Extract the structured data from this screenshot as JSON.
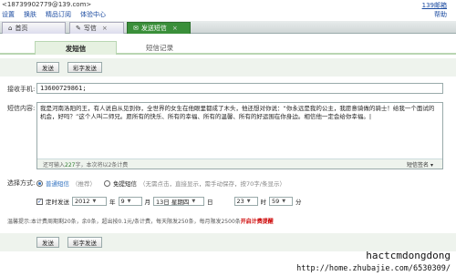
{
  "topbar": {
    "account": "<18739902779@139.com>",
    "links": [
      "设置",
      "换肤",
      "精品订阅",
      "体验中心"
    ],
    "brand": "139邮箱",
    "help": "帮助"
  },
  "tabs": [
    {
      "label": "首页"
    },
    {
      "label": "写信"
    },
    {
      "label": "发送短信"
    }
  ],
  "subtabs": {
    "active": "发短信",
    "other": "短信记录"
  },
  "buttons": {
    "send": "发送",
    "mms_send": "彩字发送"
  },
  "phone": {
    "label": "接收手机:",
    "value": "13600729861;"
  },
  "message": {
    "label": "短信内容:",
    "text": "我是河南洛阳的王，有人说自从见到你，全世界的女生在他眼里都成了木头，他还想对你说：“你永远是我的公主，我愿意骑做的骑士！给我一个面试的机会，好吗？”这个人叫二师兄。愿所有的快乐、所有的幸福、所有的温馨、所有的好运围在你身边。相信他一定会给你幸福。|",
    "counter_prefix": "还可输入",
    "counter_value": "227",
    "counter_suffix": "字，本次将以2条计费",
    "signature": "短信签名"
  },
  "options": {
    "label": "选择方式:",
    "normal": "普通短信",
    "normal_note": "（推荐）",
    "flash": "免提短信",
    "flash_note": "（无需点击，直接显示，需手动保存，按70字/条显示）"
  },
  "schedule": {
    "label": "定时发送",
    "year": "2012",
    "year_unit": "年",
    "month": "9",
    "month_unit": "月",
    "day": "13日 星期四",
    "day_unit": "日",
    "hour": "23",
    "hour_unit": "时",
    "minute": "59",
    "minute_unit": "分"
  },
  "tip": {
    "text": "温馨提示:本计费周期剩20条，余0条，超出按0.1元/条计费，每天限发250条，每月限发2500条",
    "link": "开启计费提醒"
  },
  "watermark": {
    "line1": "hactcmdongdong",
    "line2": "http://home.zhubajie.com/6530309/"
  }
}
